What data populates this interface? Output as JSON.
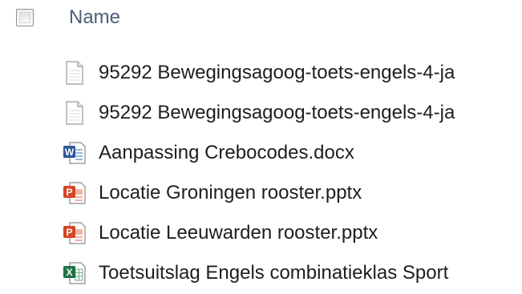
{
  "header": {
    "column_name": "Name"
  },
  "files": [
    {
      "name": "95292 Bewegingsagoog-toets-engels-4-ja",
      "icon": "generic-file-icon"
    },
    {
      "name": "95292 Bewegingsagoog-toets-engels-4-ja",
      "icon": "generic-file-icon"
    },
    {
      "name": "Aanpassing Crebocodes.docx",
      "icon": "word-document-icon"
    },
    {
      "name": "Locatie Groningen rooster.pptx",
      "icon": "powerpoint-file-icon"
    },
    {
      "name": "Locatie Leeuwarden rooster.pptx",
      "icon": "powerpoint-file-icon"
    },
    {
      "name": "Toetsuitslag Engels combinatieklas Sport",
      "icon": "excel-file-icon"
    }
  ],
  "colors": {
    "header_text": "#4c607a",
    "word_blue": "#2b5797",
    "powerpoint_red": "#d24726",
    "excel_green": "#217346"
  }
}
